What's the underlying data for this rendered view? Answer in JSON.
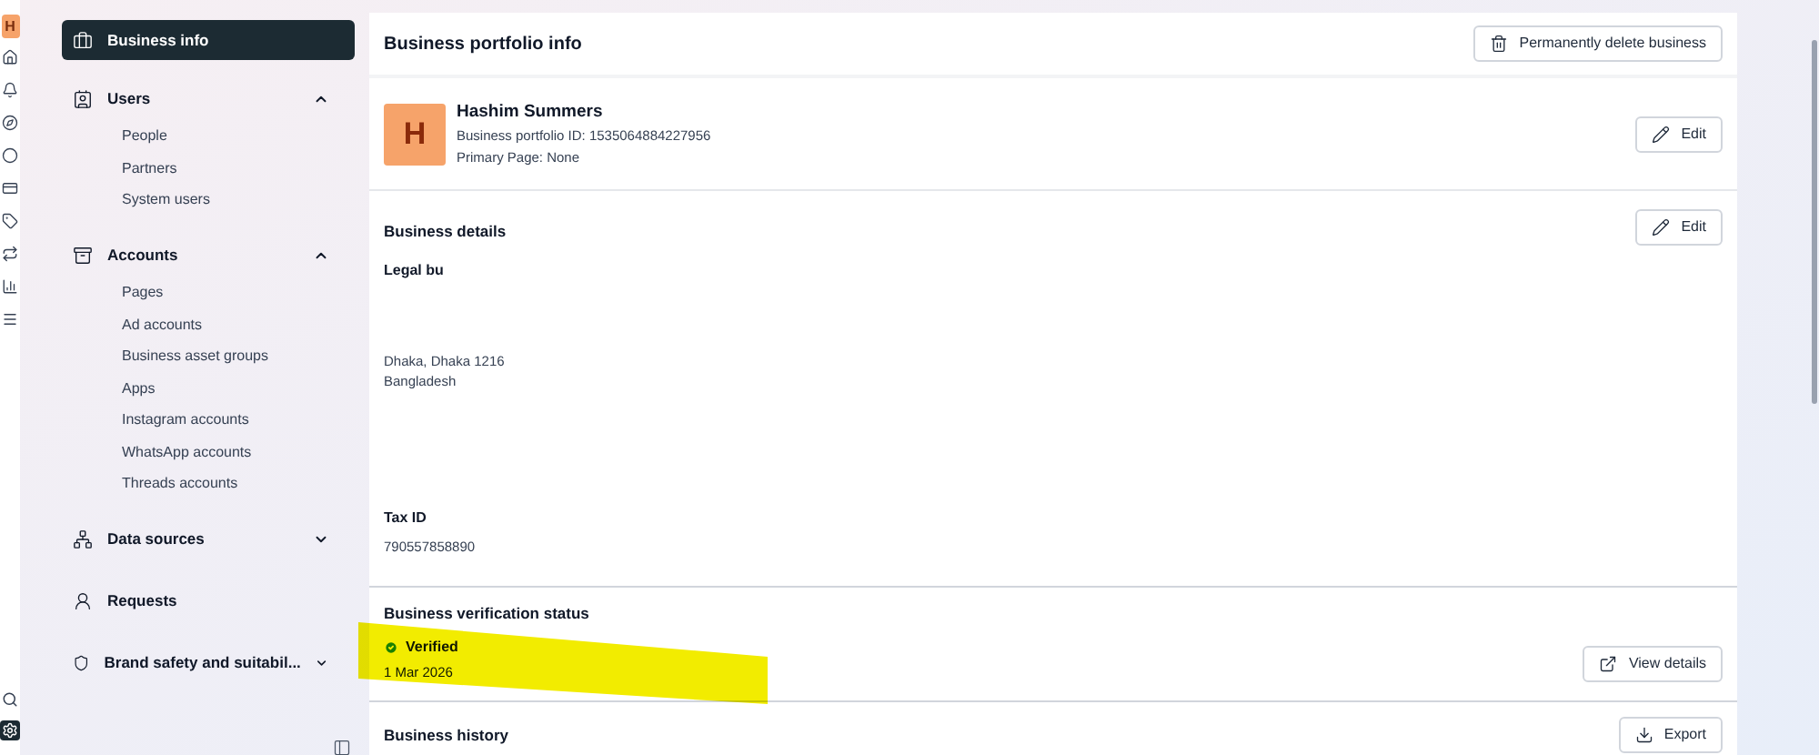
{
  "rail": {
    "avatar": "H",
    "icons": [
      {
        "kind": "home"
      },
      {
        "kind": "bell"
      },
      {
        "kind": "compass"
      },
      {
        "kind": "circle"
      },
      {
        "kind": "card"
      },
      {
        "kind": "tag"
      },
      {
        "kind": "arrows"
      },
      {
        "kind": "chart"
      },
      {
        "kind": "menu"
      }
    ],
    "bottom": [
      {
        "kind": "search",
        "selected": false
      },
      {
        "kind": "gear",
        "selected": true
      }
    ]
  },
  "sidebar": {
    "items": [
      {
        "label": "Business info",
        "kind": "briefcase",
        "selected": true
      },
      {
        "label": "Users",
        "kind": "badge",
        "expanded": true,
        "children": [
          {
            "label": "People"
          },
          {
            "label": "Partners"
          },
          {
            "label": "System users"
          }
        ]
      },
      {
        "label": "Accounts",
        "kind": "box",
        "expanded": true,
        "children": [
          {
            "label": "Pages"
          },
          {
            "label": "Ad accounts"
          },
          {
            "label": "Business asset groups"
          },
          {
            "label": "Apps"
          },
          {
            "label": "Instagram accounts"
          },
          {
            "label": "WhatsApp accounts"
          },
          {
            "label": "Threads accounts"
          }
        ]
      },
      {
        "label": "Data sources",
        "kind": "nodes",
        "expanded": false
      },
      {
        "label": "Requests",
        "kind": "person"
      },
      {
        "label": "Brand safety and suitabil...",
        "kind": "shield",
        "expanded": false
      }
    ]
  },
  "main": {
    "title": "Business portfolio info",
    "delete_button": "Permanently delete business",
    "profile": {
      "initial": "H",
      "name": "Hashim Summers",
      "id_line": "Business portfolio ID: 1535064884227956",
      "primary_page": "Primary Page: None",
      "edit": "Edit"
    },
    "details": {
      "title": "Business details",
      "edit": "Edit",
      "legal_label": "Legal bu",
      "address_lines": [
        "Dhaka, Dhaka 1216",
        "Bangladesh"
      ],
      "tax_label": "Tax ID",
      "tax_value": "790557858890"
    },
    "verification": {
      "title": "Business verification status",
      "status": "Verified",
      "verified": true,
      "date": "1 Mar 2026",
      "button": "View details"
    },
    "history": {
      "title": "Business history",
      "button": "Export"
    }
  }
}
